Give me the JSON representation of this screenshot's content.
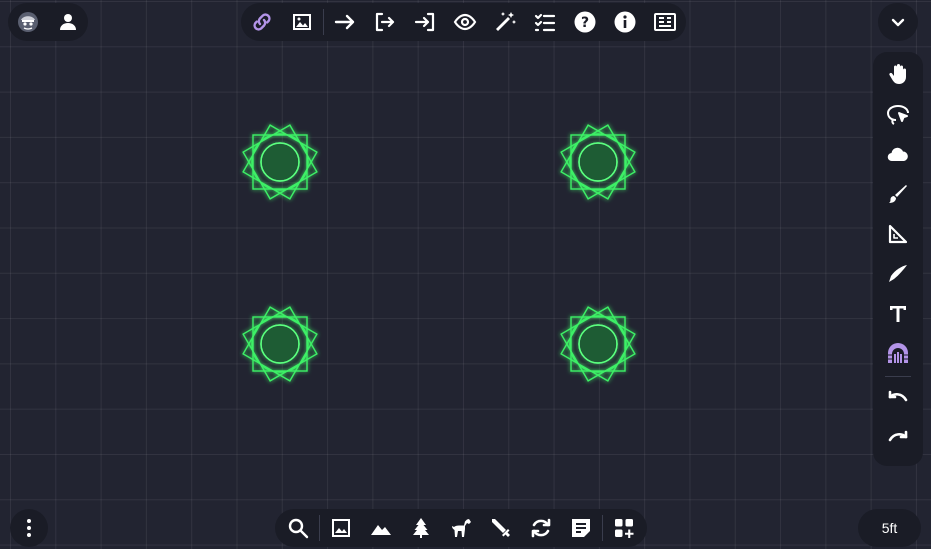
{
  "top_left": {
    "icons": [
      "gm-avatar-icon",
      "player-icon"
    ]
  },
  "top_center": {
    "icons": [
      "link-icon",
      "image-icon",
      "arrow-right-icon",
      "exit-arrow-icon",
      "enter-arrow-icon",
      "eye-icon",
      "magic-wand-icon",
      "checklist-icon",
      "help-icon",
      "info-icon",
      "notes-icon"
    ]
  },
  "top_right": {
    "icons": [
      "chevron-down-icon"
    ]
  },
  "right_bar": {
    "icons": [
      "hand-icon",
      "lasso-select-icon",
      "fog-cloud-icon",
      "brush-icon",
      "ruler-icon",
      "pointer-icon",
      "text-icon",
      "wall-door-icon",
      "undo-icon",
      "redo-icon"
    ],
    "active": "wall-door-icon"
  },
  "bottom_left": {
    "icons": [
      "more-vertical-icon"
    ]
  },
  "bottom_center": {
    "icons": [
      "search-icon",
      "image-icon",
      "terrain-icon",
      "tree-icon",
      "horse-icon",
      "sword-icon",
      "refresh-icon",
      "note-icon",
      "add-widget-icon"
    ]
  },
  "bottom_right": {
    "grid_scale": "5ft"
  },
  "colors": {
    "accent": "#b394e8",
    "token_glow": "#3df066",
    "token_fill": "#1e5c34",
    "background": "#222431",
    "panel": "#1a1c26"
  },
  "tokens": {
    "count": 4,
    "color": "#3df066"
  }
}
